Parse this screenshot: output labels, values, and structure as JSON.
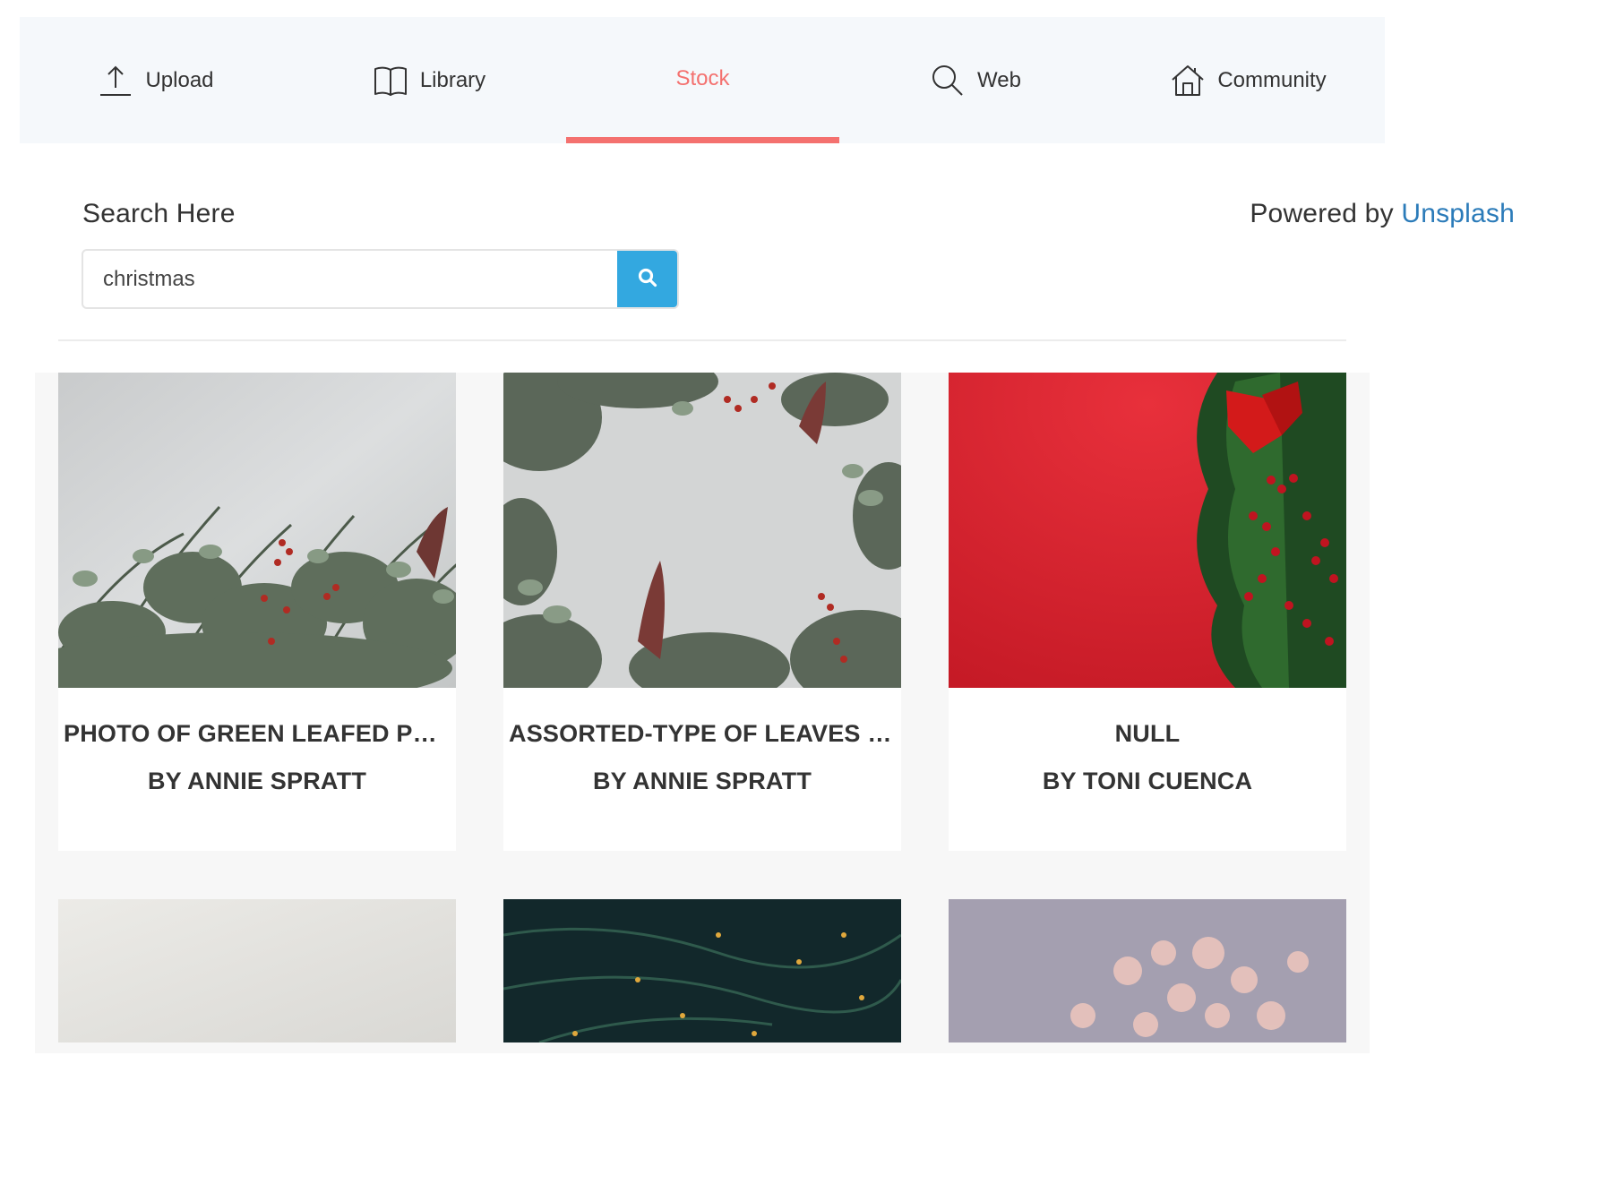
{
  "tabs": [
    {
      "label": "Upload",
      "icon": "upload-icon",
      "active": false
    },
    {
      "label": "Library",
      "icon": "book-icon",
      "active": false
    },
    {
      "label": "Stock",
      "icon": "",
      "active": true
    },
    {
      "label": "Web",
      "icon": "search-icon",
      "active": false
    },
    {
      "label": "Community",
      "icon": "home-icon",
      "active": false
    }
  ],
  "search": {
    "heading": "Search Here",
    "value": "christmas",
    "button_icon": "search-icon"
  },
  "powered": {
    "prefix": "Powered by",
    "link": "Unsplash"
  },
  "results": [
    {
      "title": "PHOTO OF GREEN LEAFED PLANT",
      "author": "BY ANNIE SPRATT"
    },
    {
      "title": "ASSORTED-TYPE OF LEAVES LAID",
      "author": "BY ANNIE SPRATT"
    },
    {
      "title": "NULL",
      "author": "BY TONI CUENCA"
    }
  ],
  "colors": {
    "accent": "#f4716f",
    "search_button": "#33a8e0",
    "link": "#2b7bb9",
    "tabbar_bg": "#f5f8fb"
  }
}
